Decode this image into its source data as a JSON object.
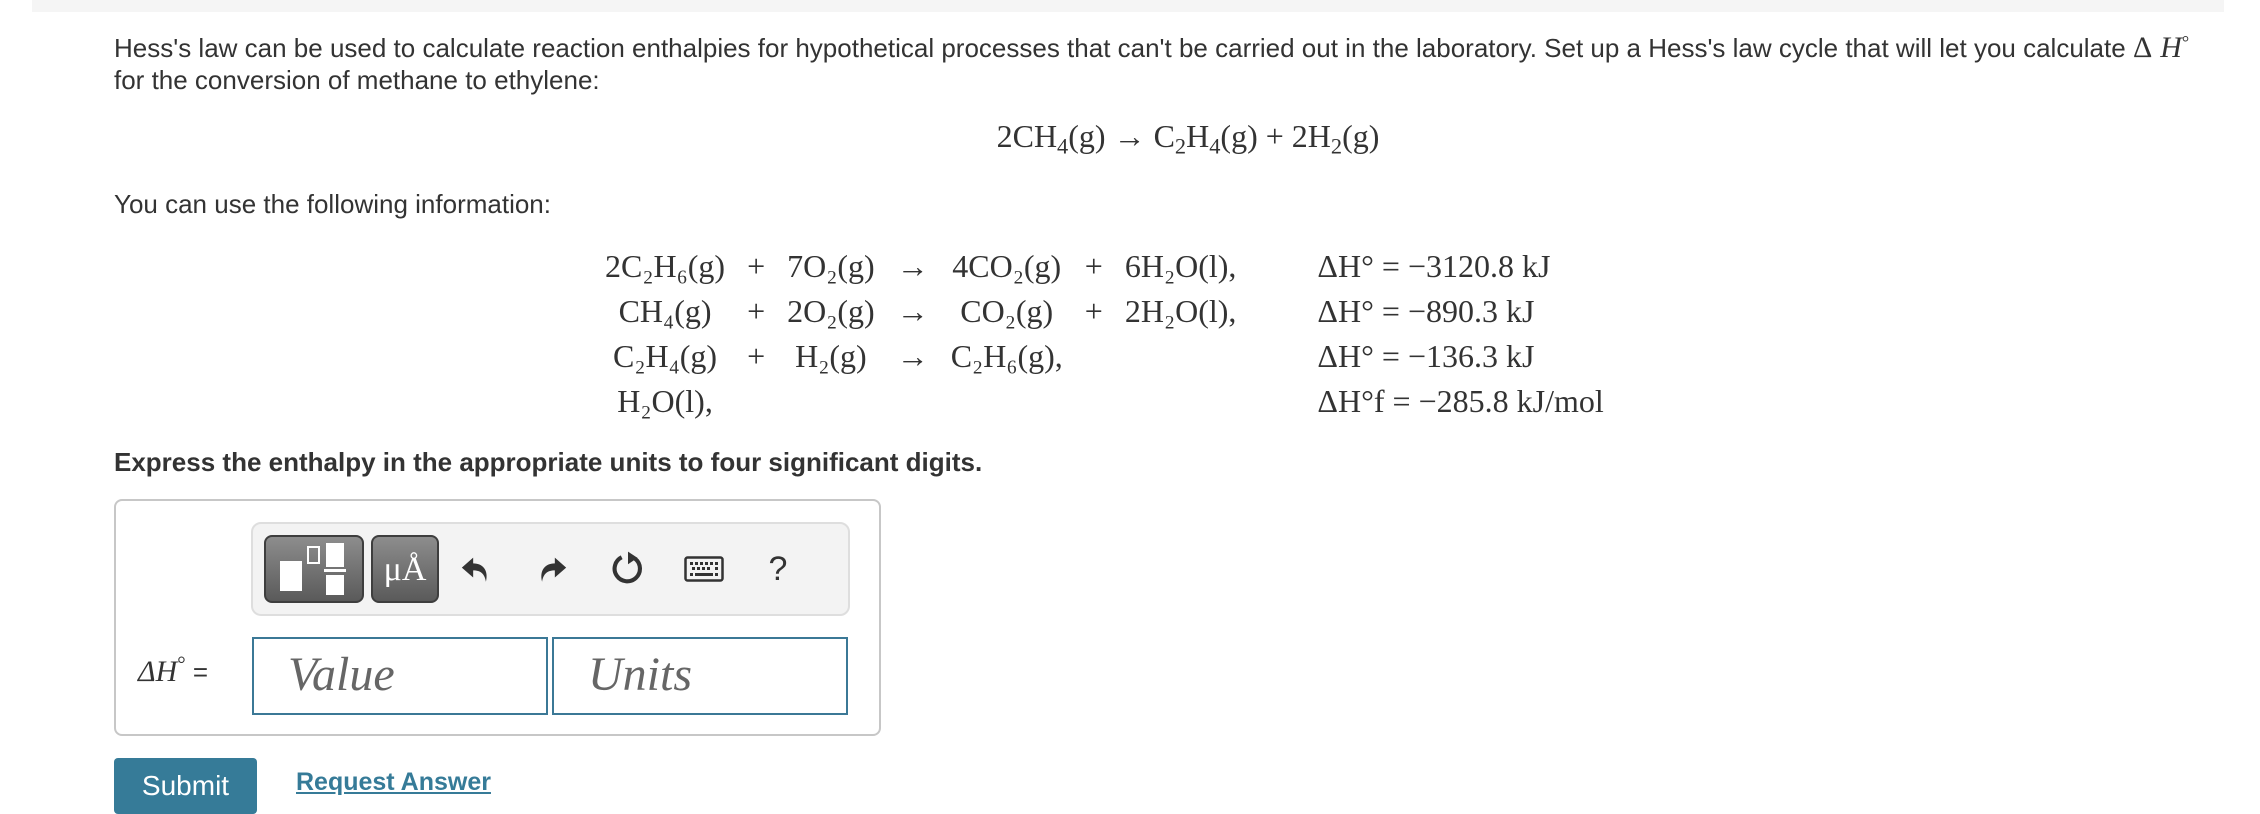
{
  "intro": {
    "text": "Hess's law can be used to calculate reaction enthalpies for hypothetical processes that can't be carried out in the laboratory. Set up a Hess's law cycle that will let you calculate ",
    "symbol_delta": "Δ",
    "symbol_H": "H",
    "symbol_degree": "°",
    "text_after": " for the conversion of methane to ethylene:"
  },
  "target_reaction": {
    "lhs_coef": "2CH",
    "lhs_sub": "4",
    "lhs_state": "(g)",
    "arrow": "→",
    "p1": "C",
    "p1_sub1": "2",
    "p1_mid": "H",
    "p1_sub2": "4",
    "p1_state": "(g)",
    "plus": "+",
    "p2": "2H",
    "p2_sub": "2",
    "p2_state": "(g)"
  },
  "info_label": "You can use the following information:",
  "reactions": [
    {
      "r1": "2C₂H₆(g)",
      "plus1": "+",
      "r2": "7O₂(g)",
      "arrow": "→",
      "p1": "4CO₂(g)",
      "plus2": "+",
      "p2": "6H₂O(l),",
      "dh": "ΔH° = −3120.8 kJ"
    },
    {
      "r1": "CH₄(g)",
      "plus1": "+",
      "r2": "2O₂(g)",
      "arrow": "→",
      "p1": "CO₂(g)",
      "plus2": "+",
      "p2": "2H₂O(l),",
      "dh": "ΔH° = −890.3 kJ"
    },
    {
      "r1": "C₂H₄(g)",
      "plus1": "+",
      "r2": "H₂(g)",
      "arrow": "→",
      "p1": "C₂H₆(g),",
      "plus2": "",
      "p2": "",
      "dh": "ΔH° = −136.3 kJ"
    },
    {
      "r1": "H₂O(l),",
      "plus1": "",
      "r2": "",
      "arrow": "",
      "p1": "",
      "plus2": "",
      "p2": "",
      "dh": "ΔH°f = −285.8 kJ/mol"
    }
  ],
  "instruction": "Express the enthalpy in the appropriate units to four significant digits.",
  "toolbar": {
    "templates_icon": "templates-icon",
    "units_label": "μÅ",
    "undo_icon": "undo-icon",
    "redo_icon": "redo-icon",
    "reset_icon": "reset-icon",
    "keyboard_icon": "keyboard-icon",
    "help_label": "?"
  },
  "answer": {
    "label_delta": "ΔH",
    "label_degree": "°",
    "label_eq": " =",
    "value_placeholder": "Value",
    "units_placeholder": "Units"
  },
  "actions": {
    "submit_label": "Submit",
    "request_label": "Request Answer"
  },
  "colors": {
    "accent": "#367b98",
    "input_border": "#3b7896",
    "toolbar_bg": "#f3f3f3"
  }
}
